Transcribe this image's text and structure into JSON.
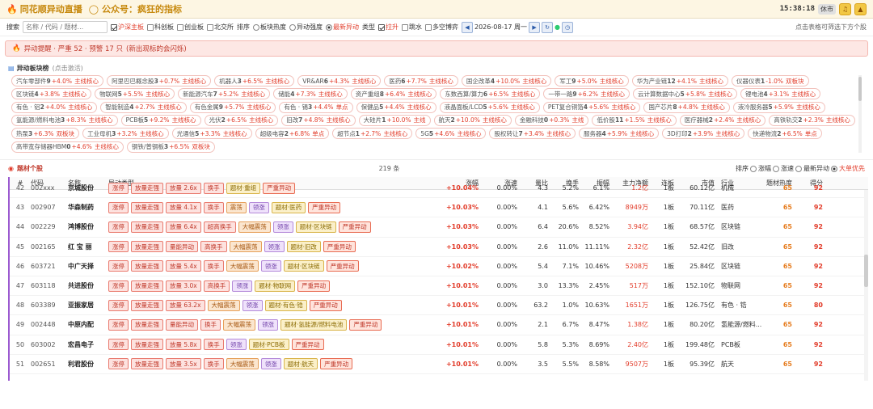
{
  "titlebar": {
    "app_title": "同花顺异动直播",
    "bubble_icon": "speech-bubble-icon",
    "gzh": "公众号：疯狂的指标",
    "clock": "15:38:18",
    "status": "休市",
    "buttons": [
      "bell-icon",
      "alert-icon"
    ]
  },
  "toolbar": {
    "search_label": "搜索",
    "search_placeholder": "名称 / 代码 / 题材...",
    "filters": [
      {
        "label": "沪深主板",
        "checked": true,
        "red": true
      },
      {
        "label": "科创板",
        "checked": false
      },
      {
        "label": "创业板",
        "checked": false
      },
      {
        "label": "北交所",
        "checked": false
      }
    ],
    "sort_label": "排序",
    "sort_options": [
      {
        "label": "板块热度",
        "on": false
      },
      {
        "label": "异动强度",
        "on": false
      },
      {
        "label": "最新异动",
        "on": true,
        "red": true
      }
    ],
    "type_label": "类型",
    "type_options": [
      {
        "label": "拉升",
        "checked": true,
        "red": true
      },
      {
        "label": "跳水",
        "checked": false
      },
      {
        "label": "多空博弈",
        "checked": false
      }
    ],
    "date": "2026-08-17 周一",
    "hint": "点击表格可筛选下方个股"
  },
  "alert": {
    "text": "异动提醒 · 严重 52 · 预警 17 只",
    "sub": "(新出现标的会闪烁)"
  },
  "sector_section": {
    "title": "异动板块榜",
    "sub": "(点击激活)",
    "tags": [
      {
        "name": "汽车零部件",
        "n": "9",
        "pct": "+4.0%",
        "core": "主线核心"
      },
      {
        "name": "阿里巴巴概念股",
        "n": "3",
        "pct": "+0.7%",
        "core": "主线核心"
      },
      {
        "name": "机器人",
        "n": "3",
        "pct": "+6.5%",
        "core": "主线核心"
      },
      {
        "name": "VR&AR",
        "n": "6",
        "pct": "+4.3%",
        "core": "主线核心"
      },
      {
        "name": "医药",
        "n": "6",
        "pct": "+7.7%",
        "core": "主线核心"
      },
      {
        "name": "国企改革",
        "n": "4",
        "pct": "+10.0%",
        "core": "主线核心"
      },
      {
        "name": "军工",
        "n": "9",
        "pct": "+5.0%",
        "core": "主线核心"
      },
      {
        "name": "华为产业链",
        "n": "12",
        "pct": "+4.1%",
        "core": "主线核心"
      },
      {
        "name": "仪器仪表",
        "n": "1",
        "pct": "-1.0%",
        "core": "双板块"
      },
      {
        "name": "区块链",
        "n": "4",
        "pct": "+3.8%",
        "core": "主线核心"
      },
      {
        "name": "物联网",
        "n": "5",
        "pct": "+5.5%",
        "core": "主线核心"
      },
      {
        "name": "新能源汽车",
        "n": "7",
        "pct": "+5.2%",
        "core": "主线核心"
      },
      {
        "name": "储能",
        "n": "4",
        "pct": "+7.3%",
        "core": "主线核心"
      },
      {
        "name": "资产重组",
        "n": "8",
        "pct": "+6.4%",
        "core": "主线核心"
      },
      {
        "name": "东数西算/算力",
        "n": "6",
        "pct": "+6.5%",
        "core": "主线核心"
      },
      {
        "name": "一带一路",
        "n": "9",
        "pct": "+6.2%",
        "core": "主线核心"
      },
      {
        "name": "云计算数据中心",
        "n": "5",
        "pct": "+5.8%",
        "core": "主线核心"
      },
      {
        "name": "锂电池",
        "n": "4",
        "pct": "+3.1%",
        "core": "主线核心"
      },
      {
        "name": "有色 · 铝",
        "n": "2",
        "pct": "+4.0%",
        "core": "主线核心"
      },
      {
        "name": "智能制造",
        "n": "4",
        "pct": "+2.7%",
        "core": "主线核心"
      },
      {
        "name": "有色金属",
        "n": "9",
        "pct": "+5.7%",
        "core": "主线核心"
      },
      {
        "name": "有色 · 锡",
        "n": "3",
        "pct": "+4.4%",
        "core": "单点"
      },
      {
        "name": "保健品",
        "n": "5",
        "pct": "+4.4%",
        "core": "主线核心"
      },
      {
        "name": "液晶面板/LCD",
        "n": "5",
        "pct": "+5.6%",
        "core": "主线核心"
      },
      {
        "name": "PET复合铜箔",
        "n": "4",
        "pct": "+5.6%",
        "core": "主线核心"
      },
      {
        "name": "国产芯片",
        "n": "8",
        "pct": "+4.8%",
        "core": "主线核心"
      },
      {
        "name": "液冷服务器",
        "n": "5",
        "pct": "+5.9%",
        "core": "主线核心"
      },
      {
        "name": "氢能源/燃料电池",
        "n": "3",
        "pct": "+8.3%",
        "core": "主线核心"
      },
      {
        "name": "PCB板",
        "n": "5",
        "pct": "+9.2%",
        "core": "主线核心"
      },
      {
        "name": "光伏",
        "n": "2",
        "pct": "+6.5%",
        "core": "主线核心"
      },
      {
        "name": "旧改",
        "n": "7",
        "pct": "+4.8%",
        "core": "主线核心"
      },
      {
        "name": "大硅片",
        "n": "1",
        "pct": "+10.0%",
        "core": "主线"
      },
      {
        "name": "航天",
        "n": "2",
        "pct": "+10.0%",
        "core": "主线核心"
      },
      {
        "name": "金融科技",
        "n": "0",
        "pct": "+0.3%",
        "core": "主线"
      },
      {
        "name": "低价股",
        "n": "11",
        "pct": "+1.5%",
        "core": "主线核心"
      },
      {
        "name": "医疗器械",
        "n": "2",
        "pct": "+2.4%",
        "core": "主线核心"
      },
      {
        "name": "高铁轨交",
        "n": "2",
        "pct": "+2.3%",
        "core": "主线核心"
      },
      {
        "name": "热泵",
        "n": "3",
        "pct": "+6.3%",
        "core": "双板块"
      },
      {
        "name": "工业母机",
        "n": "3",
        "pct": "+3.2%",
        "core": "主线核心"
      },
      {
        "name": "光通信",
        "n": "5",
        "pct": "+3.3%",
        "core": "主线核心"
      },
      {
        "name": "超级电容",
        "n": "2",
        "pct": "+6.8%",
        "core": "单点"
      },
      {
        "name": "超节点",
        "n": "1",
        "pct": "+2.7%",
        "core": "主线核心"
      },
      {
        "name": "5G",
        "n": "5",
        "pct": "+4.6%",
        "core": "主线核心"
      },
      {
        "name": "股权转让",
        "n": "7",
        "pct": "+3.4%",
        "core": "主线核心"
      },
      {
        "name": "服务器",
        "n": "4",
        "pct": "+5.9%",
        "core": "主线核心"
      },
      {
        "name": "3D打印",
        "n": "2",
        "pct": "+3.9%",
        "core": "主线核心"
      },
      {
        "name": "快递物流",
        "n": "2",
        "pct": "+6.5%",
        "core": "单点"
      },
      {
        "name": "高带宽存储器HBM",
        "n": "0",
        "pct": "+4.6%",
        "core": "主线核心"
      },
      {
        "name": "钢铁/普钢板",
        "n": "3",
        "pct": "+6.5%",
        "core": "双板块"
      }
    ]
  },
  "stock_section": {
    "title": "题材个股",
    "count": "219 条",
    "sort_label": "排序",
    "sort_options": [
      {
        "label": "涨幅",
        "on": false
      },
      {
        "label": "涨速",
        "on": false
      },
      {
        "label": "最新异动",
        "on": false
      },
      {
        "label": "大单优先",
        "on": true,
        "red": true
      }
    ]
  },
  "table": {
    "headers": [
      "#",
      "代码",
      "名称",
      "异动类型",
      "涨幅",
      "涨速",
      "量比",
      "换手",
      "振幅",
      "主力净额",
      "连板",
      "市值",
      "行业",
      "题材热度",
      "得分"
    ],
    "rows": [
      {
        "num": "42",
        "code": "002xxx",
        "name": "京城股份",
        "types": [
          [
            "涨停",
            "r"
          ],
          [
            "放量走强",
            "r"
          ],
          [
            "放量 2.6x",
            "r"
          ],
          [
            "换手",
            "r"
          ],
          [
            "题材·重组",
            "y"
          ],
          [
            "严重异动",
            "g"
          ]
        ],
        "pct": "+10.04%",
        "spd": "0.00%",
        "lb": "4.3",
        "hs": "5.2%",
        "zf": "6.1%",
        "zl": "1.2亿",
        "lian": "1板",
        "sz": "60.12亿",
        "ind": "机械",
        "heat": "65",
        "score": "92"
      },
      {
        "num": "43",
        "code": "002907",
        "name": "华森制药",
        "types": [
          [
            "涨停",
            "r"
          ],
          [
            "放量走强",
            "r"
          ],
          [
            "放量 4.1x",
            "r"
          ],
          [
            "换手",
            "r"
          ],
          [
            "震荡",
            "o"
          ],
          [
            "领涨",
            "p"
          ],
          [
            "题材·医药",
            "y"
          ],
          [
            "严重异动",
            "g"
          ]
        ],
        "pct": "+10.03%",
        "spd": "0.00%",
        "lb": "4.1",
        "hs": "5.6%",
        "zf": "6.42%",
        "zl": "8949万",
        "lian": "1板",
        "sz": "70.11亿",
        "ind": "医药",
        "heat": "65",
        "score": "92"
      },
      {
        "num": "44",
        "code": "002229",
        "name": "鸿博股份",
        "types": [
          [
            "涨停",
            "r"
          ],
          [
            "放量走强",
            "r"
          ],
          [
            "放量 6.4x",
            "r"
          ],
          [
            "超高换手",
            "r"
          ],
          [
            "大幅震荡",
            "o"
          ],
          [
            "领涨",
            "p"
          ],
          [
            "题材·区块链",
            "y"
          ],
          [
            "严重异动",
            "g"
          ]
        ],
        "pct": "+10.03%",
        "spd": "0.00%",
        "lb": "6.4",
        "hs": "20.6%",
        "zf": "8.52%",
        "zl": "3.94亿",
        "lian": "1板",
        "sz": "68.57亿",
        "ind": "区块链",
        "heat": "65",
        "score": "92"
      },
      {
        "num": "45",
        "code": "002165",
        "name": "红 宝 丽",
        "types": [
          [
            "涨停",
            "r"
          ],
          [
            "放量走强",
            "r"
          ],
          [
            "量能异动",
            "r"
          ],
          [
            "高换手",
            "r"
          ],
          [
            "大幅震荡",
            "o"
          ],
          [
            "领涨",
            "p"
          ],
          [
            "题材·旧改",
            "y"
          ],
          [
            "严重异动",
            "g"
          ]
        ],
        "pct": "+10.03%",
        "spd": "0.00%",
        "lb": "2.6",
        "hs": "11.0%",
        "zf": "11.11%",
        "zl": "2.32亿",
        "lian": "1板",
        "sz": "52.42亿",
        "ind": "旧改",
        "heat": "65",
        "score": "92"
      },
      {
        "num": "46",
        "code": "603721",
        "name": "中广天择",
        "types": [
          [
            "涨停",
            "r"
          ],
          [
            "放量走强",
            "r"
          ],
          [
            "放量 5.4x",
            "r"
          ],
          [
            "换手",
            "r"
          ],
          [
            "大幅震荡",
            "o"
          ],
          [
            "领涨",
            "p"
          ],
          [
            "题材·区块链",
            "y"
          ],
          [
            "严重异动",
            "g"
          ]
        ],
        "pct": "+10.02%",
        "spd": "0.00%",
        "lb": "5.4",
        "hs": "7.1%",
        "zf": "10.46%",
        "zl": "5208万",
        "lian": "1板",
        "sz": "25.84亿",
        "ind": "区块链",
        "heat": "65",
        "score": "92"
      },
      {
        "num": "47",
        "code": "603118",
        "name": "共进股份",
        "types": [
          [
            "涨停",
            "r"
          ],
          [
            "放量走强",
            "r"
          ],
          [
            "放量 3.0x",
            "r"
          ],
          [
            "高换手",
            "r"
          ],
          [
            "领涨",
            "p"
          ],
          [
            "题材·物联网",
            "y"
          ],
          [
            "严重异动",
            "g"
          ]
        ],
        "pct": "+10.01%",
        "spd": "0.00%",
        "lb": "3.0",
        "hs": "13.3%",
        "zf": "2.45%",
        "zl": "517万",
        "lian": "1板",
        "sz": "152.10亿",
        "ind": "物联网",
        "heat": "65",
        "score": "92"
      },
      {
        "num": "48",
        "code": "603389",
        "name": "亚振家居",
        "types": [
          [
            "涨停",
            "r"
          ],
          [
            "放量走强",
            "r"
          ],
          [
            "放量 63.2x",
            "r"
          ],
          [
            "大幅震荡",
            "o"
          ],
          [
            "领涨",
            "p"
          ],
          [
            "题材·有色·锆",
            "y"
          ],
          [
            "严重异动",
            "g"
          ]
        ],
        "pct": "+10.01%",
        "spd": "0.00%",
        "lb": "63.2",
        "hs": "1.0%",
        "zf": "10.63%",
        "zl": "1651万",
        "lian": "1板",
        "sz": "126.75亿",
        "ind": "有色 · 锆",
        "heat": "65",
        "score": "80"
      },
      {
        "num": "49",
        "code": "002448",
        "name": "中原内配",
        "types": [
          [
            "涨停",
            "r"
          ],
          [
            "放量走强",
            "r"
          ],
          [
            "量能异动",
            "r"
          ],
          [
            "换手",
            "r"
          ],
          [
            "大幅震荡",
            "o"
          ],
          [
            "领涨",
            "p"
          ],
          [
            "题材·氢能源/燃料电池",
            "y"
          ],
          [
            "严重异动",
            "g"
          ]
        ],
        "pct": "+10.01%",
        "spd": "0.00%",
        "lb": "2.1",
        "hs": "6.7%",
        "zf": "8.47%",
        "zl": "1.38亿",
        "lian": "1板",
        "sz": "80.20亿",
        "ind": "氢能源/燃料...",
        "heat": "65",
        "score": "92"
      },
      {
        "num": "50",
        "code": "603002",
        "name": "宏昌电子",
        "types": [
          [
            "涨停",
            "r"
          ],
          [
            "放量走强",
            "r"
          ],
          [
            "放量 5.8x",
            "r"
          ],
          [
            "换手",
            "r"
          ],
          [
            "领涨",
            "p"
          ],
          [
            "题材·PCB板",
            "y"
          ],
          [
            "严重异动",
            "g"
          ]
        ],
        "pct": "+10.01%",
        "spd": "0.00%",
        "lb": "5.8",
        "hs": "5.3%",
        "zf": "8.69%",
        "zl": "2.40亿",
        "lian": "1板",
        "sz": "199.48亿",
        "ind": "PCB板",
        "heat": "65",
        "score": "92"
      },
      {
        "num": "51",
        "code": "002651",
        "name": "利君股份",
        "types": [
          [
            "涨停",
            "r"
          ],
          [
            "放量走强",
            "r"
          ],
          [
            "放量 3.5x",
            "r"
          ],
          [
            "换手",
            "r"
          ],
          [
            "大幅震荡",
            "o"
          ],
          [
            "领涨",
            "p"
          ],
          [
            "题材·航天",
            "y"
          ],
          [
            "严重异动",
            "g"
          ]
        ],
        "pct": "+10.01%",
        "spd": "0.00%",
        "lb": "3.5",
        "hs": "5.5%",
        "zf": "8.58%",
        "zl": "9507万",
        "lian": "1板",
        "sz": "95.39亿",
        "ind": "航天",
        "heat": "65",
        "score": "92"
      }
    ]
  }
}
